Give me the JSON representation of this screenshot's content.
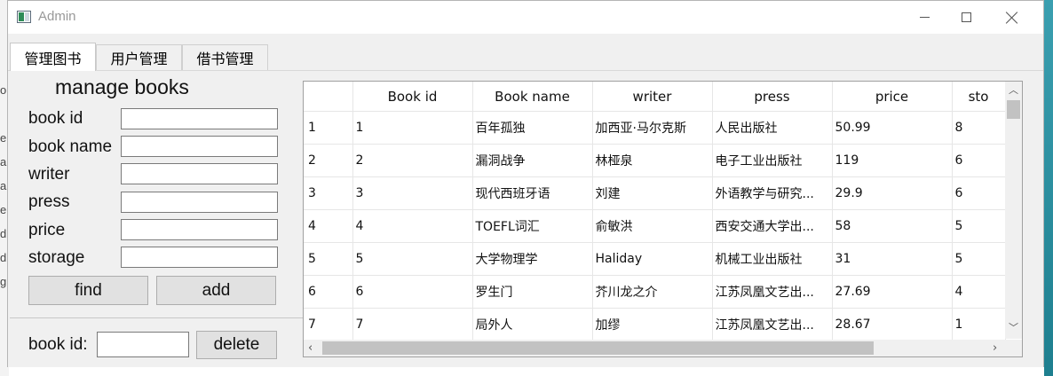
{
  "window": {
    "title": "Admin"
  },
  "background_app": {
    "letters": [
      "o",
      "er",
      "ar",
      "ar",
      "e",
      "d",
      "d",
      "g"
    ]
  },
  "tabs": [
    {
      "label": "管理图书",
      "active": true
    },
    {
      "label": "用户管理",
      "active": false
    },
    {
      "label": "借书管理",
      "active": false
    }
  ],
  "form": {
    "title": "manage books",
    "fields": [
      {
        "label": "book id",
        "value": ""
      },
      {
        "label": "book name",
        "value": ""
      },
      {
        "label": "writer",
        "value": ""
      },
      {
        "label": "press",
        "value": ""
      },
      {
        "label": "price",
        "value": ""
      },
      {
        "label": "storage",
        "value": ""
      }
    ],
    "find_label": "find",
    "add_label": "add",
    "delete_field_label": "book id:",
    "delete_value": "",
    "delete_label": "delete"
  },
  "table": {
    "columns": [
      "Book id",
      "Book name",
      "writer",
      "press",
      "price",
      "sto"
    ],
    "rows": [
      {
        "num": "1",
        "cells": [
          "1",
          "百年孤独",
          "加西亚·马尔克斯",
          "人民出版社",
          "50.99",
          "8"
        ]
      },
      {
        "num": "2",
        "cells": [
          "2",
          "漏洞战争",
          "林桠泉",
          "电子工业出版社",
          "119",
          "6"
        ]
      },
      {
        "num": "3",
        "cells": [
          "3",
          "现代西班牙语",
          "刘建",
          "外语教学与研究...",
          "29.9",
          "6"
        ]
      },
      {
        "num": "4",
        "cells": [
          "4",
          "TOEFL词汇",
          "俞敏洪",
          "西安交通大学出...",
          "58",
          "5"
        ]
      },
      {
        "num": "5",
        "cells": [
          "5",
          "大学物理学",
          "Haliday",
          "机械工业出版社",
          "31",
          "5"
        ]
      },
      {
        "num": "6",
        "cells": [
          "6",
          "罗生门",
          "芥川龙之介",
          "江苏凤凰文艺出...",
          "27.69",
          "4"
        ]
      },
      {
        "num": "7",
        "cells": [
          "7",
          "局外人",
          "加缪",
          "江苏凤凰文艺出...",
          "28.67",
          "1"
        ]
      }
    ]
  }
}
